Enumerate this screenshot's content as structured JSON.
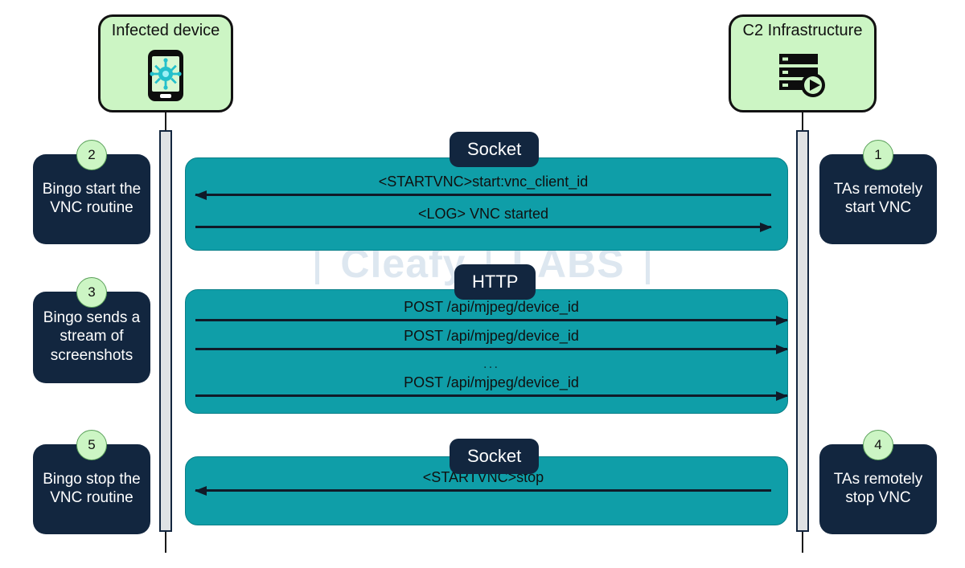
{
  "watermark": {
    "word1": "Cleafy",
    "word2": "LABS"
  },
  "actors": [
    {
      "id": "infected-device",
      "label": "Infected device",
      "icon": "infected-phone-icon"
    },
    {
      "id": "c2-infrastructure",
      "label": "C2 Infrastructure",
      "icon": "server-play-icon"
    }
  ],
  "steps": [
    {
      "number": "2",
      "text": "Bingo start the VNC routine",
      "side": "left"
    },
    {
      "number": "3",
      "text": "Bingo sends a stream of screenshots",
      "side": "left"
    },
    {
      "number": "5",
      "text": "Bingo stop the VNC routine",
      "side": "left"
    },
    {
      "number": "1",
      "text": "TAs remotely start VNC",
      "side": "right"
    },
    {
      "number": "4",
      "text": "TAs remotely stop VNC",
      "side": "right"
    }
  ],
  "fragments": [
    {
      "tag": "Socket",
      "messages": [
        {
          "label": "<STARTVNC>start:vnc_client_id",
          "direction": "left"
        },
        {
          "label": "<LOG> VNC started",
          "direction": "right"
        }
      ]
    },
    {
      "tag": "HTTP",
      "messages": [
        {
          "label": "POST /api/mjpeg/device_id",
          "direction": "right"
        },
        {
          "label": "POST /api/mjpeg/device_id",
          "direction": "right"
        },
        {
          "label": "POST /api/mjpeg/device_id",
          "direction": "right"
        }
      ],
      "ellipsis": "..."
    },
    {
      "tag": "Socket",
      "messages": [
        {
          "label": "<STARTVNC>stop",
          "direction": "left"
        }
      ]
    }
  ],
  "colors": {
    "teal": "#0f9ea8",
    "navy": "#12263f",
    "green": "#ccf5c4",
    "activation": "#dfe2e4",
    "watermark": "#dde7f0"
  }
}
